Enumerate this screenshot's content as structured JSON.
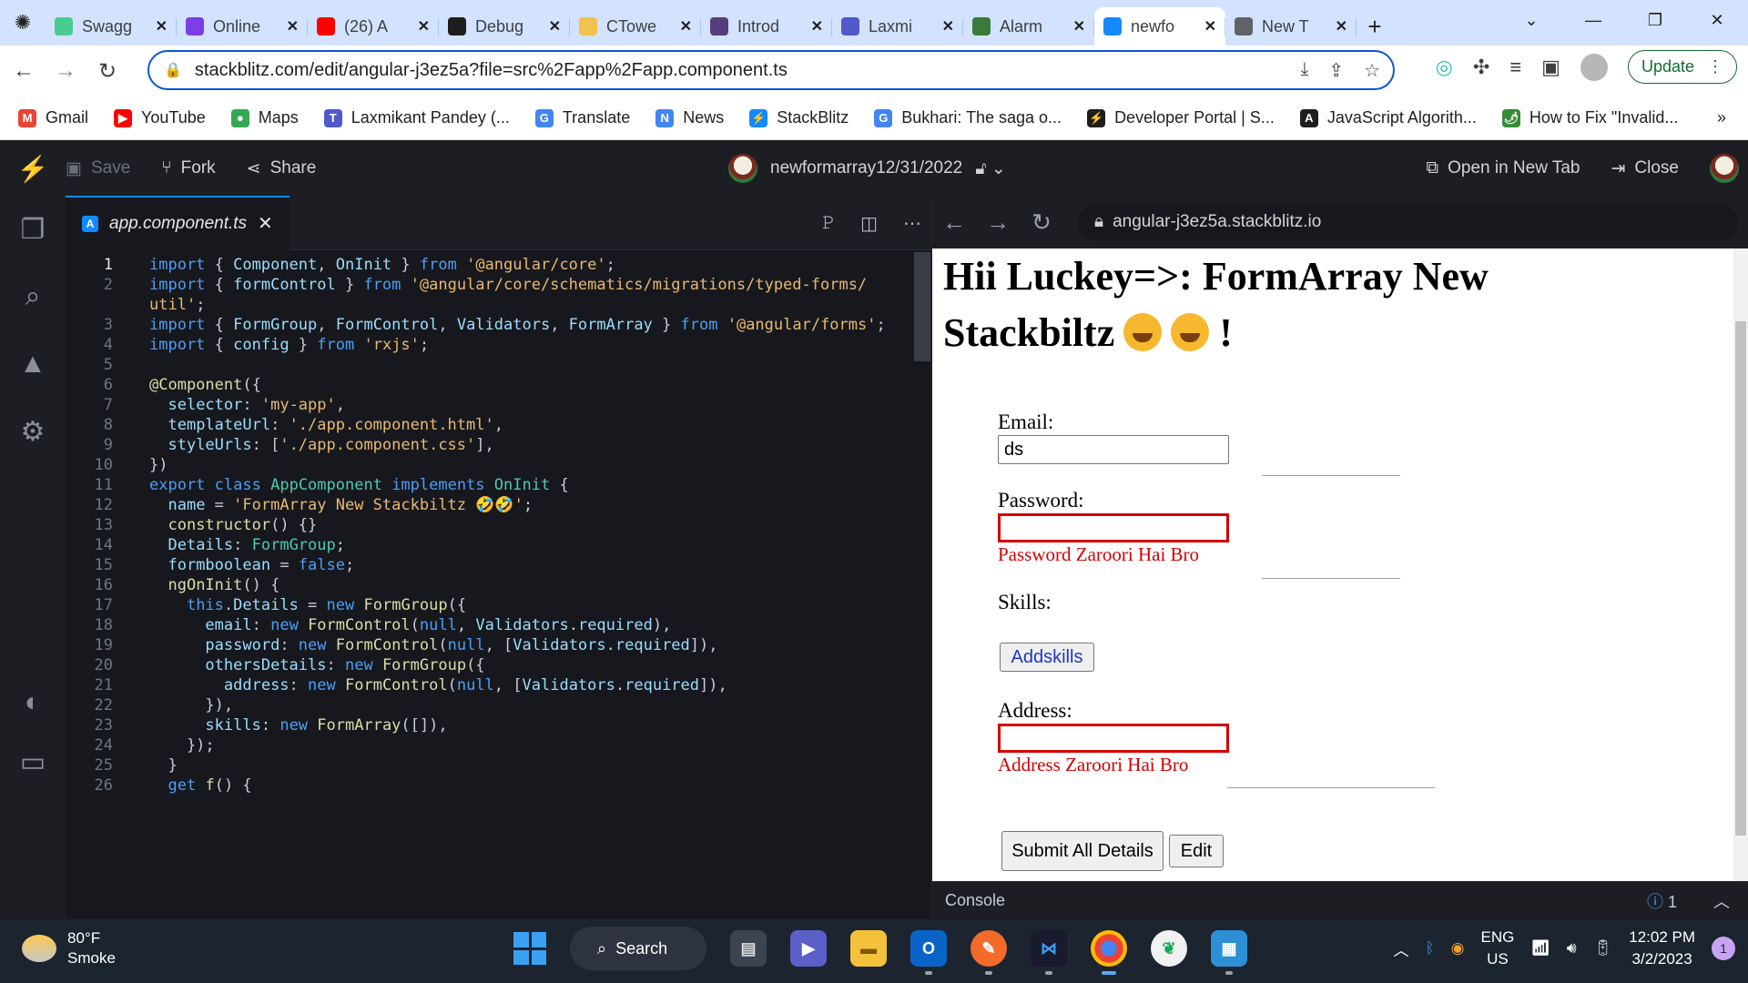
{
  "browser": {
    "tabs": [
      {
        "label": "Swagg",
        "icon": "swagger-icon",
        "color": "#49cc90"
      },
      {
        "label": "Online",
        "icon": "online-icon",
        "color": "#7b3fe4"
      },
      {
        "label": "(26) A",
        "icon": "youtube-icon",
        "color": "#ff0000"
      },
      {
        "label": "Debug",
        "icon": "debug-icon",
        "color": "#1e1e1e"
      },
      {
        "label": "CTowe",
        "icon": "ctower-icon",
        "color": "#f2c14e"
      },
      {
        "label": "Introd",
        "icon": "bootstrap-icon",
        "color": "#563d7c"
      },
      {
        "label": "Laxmi",
        "icon": "teams-icon",
        "color": "#5059c9"
      },
      {
        "label": "Alarm",
        "icon": "alarm-icon",
        "color": "#3a7a3a"
      },
      {
        "label": "newfo",
        "icon": "stackblitz-icon",
        "color": "#1389fd",
        "active": true
      },
      {
        "label": "New T",
        "icon": "chrome-icon",
        "color": "#5f6368"
      }
    ],
    "url": "stackblitz.com/edit/angular-j3ez5a?file=src%2Fapp%2Fapp.component.ts",
    "update_label": "Update",
    "bookmarks": [
      {
        "label": "Gmail",
        "color": "#ea4335",
        "glyph": "M"
      },
      {
        "label": "YouTube",
        "color": "#ff0000",
        "glyph": "▶"
      },
      {
        "label": "Maps",
        "color": "#34a853",
        "glyph": "●"
      },
      {
        "label": "Laxmikant Pandey (...",
        "color": "#5059c9",
        "glyph": "T"
      },
      {
        "label": "Translate",
        "color": "#4285f4",
        "glyph": "G"
      },
      {
        "label": "News",
        "color": "#4285f4",
        "glyph": "N"
      },
      {
        "label": "StackBlitz",
        "color": "#1389fd",
        "glyph": "⚡"
      },
      {
        "label": "Bukhari: The saga o...",
        "color": "#4285f4",
        "glyph": "G"
      },
      {
        "label": "Developer Portal | S...",
        "color": "#1e1e1e",
        "glyph": "⚡"
      },
      {
        "label": "JavaScript Algorith...",
        "color": "#1e1e1e",
        "glyph": "A"
      },
      {
        "label": "How to Fix \"Invalid...",
        "color": "#3a8a3a",
        "glyph": "🌶"
      }
    ],
    "bookmarks_more": "»"
  },
  "stackblitz": {
    "save_label": "Save",
    "fork_label": "Fork",
    "share_label": "Share",
    "project_title": "newformarray12/31/2022",
    "open_new_tab_label": "Open in New Tab",
    "close_label": "Close"
  },
  "editor": {
    "tab_label": "app.component.ts",
    "lines": [
      {
        "n": "1",
        "tokens": [
          [
            "kw",
            "import"
          ],
          [
            "pun",
            " { "
          ],
          [
            "id",
            "Component"
          ],
          [
            "pun",
            ", "
          ],
          [
            "id",
            "OnInit"
          ],
          [
            "pun",
            " } "
          ],
          [
            "kw",
            "from"
          ],
          [
            "pun",
            " "
          ],
          [
            "str",
            "'@angular/core'"
          ],
          [
            "pun",
            ";"
          ]
        ]
      },
      {
        "n": "2",
        "tokens": [
          [
            "kw",
            "import"
          ],
          [
            "pun",
            " { "
          ],
          [
            "id",
            "formControl"
          ],
          [
            "pun",
            " } "
          ],
          [
            "kw",
            "from"
          ],
          [
            "pun",
            " "
          ],
          [
            "str",
            "'@angular/core/schematics/migrations/typed-forms/"
          ]
        ]
      },
      {
        "n": "",
        "tokens": [
          [
            "str",
            "util'"
          ],
          [
            "pun",
            ";"
          ]
        ]
      },
      {
        "n": "3",
        "tokens": [
          [
            "kw",
            "import"
          ],
          [
            "pun",
            " { "
          ],
          [
            "id",
            "FormGroup"
          ],
          [
            "pun",
            ", "
          ],
          [
            "id",
            "FormControl"
          ],
          [
            "pun",
            ", "
          ],
          [
            "id",
            "Validators"
          ],
          [
            "pun",
            ", "
          ],
          [
            "id",
            "FormArray"
          ],
          [
            "pun",
            " } "
          ],
          [
            "kw",
            "from"
          ],
          [
            "pun",
            " "
          ],
          [
            "str",
            "'@angular/forms'"
          ],
          [
            "pun",
            ";"
          ]
        ]
      },
      {
        "n": "4",
        "tokens": [
          [
            "kw",
            "import"
          ],
          [
            "pun",
            " { "
          ],
          [
            "id",
            "config"
          ],
          [
            "pun",
            " } "
          ],
          [
            "kw",
            "from"
          ],
          [
            "pun",
            " "
          ],
          [
            "str",
            "'rxjs'"
          ],
          [
            "pun",
            ";"
          ]
        ]
      },
      {
        "n": "5",
        "tokens": []
      },
      {
        "n": "6",
        "tokens": [
          [
            "fn",
            "@Component"
          ],
          [
            "pun",
            "({"
          ]
        ]
      },
      {
        "n": "7",
        "tokens": [
          [
            "pun",
            "  "
          ],
          [
            "id",
            "selector"
          ],
          [
            "pun",
            ": "
          ],
          [
            "str",
            "'my-app'"
          ],
          [
            "pun",
            ","
          ]
        ]
      },
      {
        "n": "8",
        "tokens": [
          [
            "pun",
            "  "
          ],
          [
            "id",
            "templateUrl"
          ],
          [
            "pun",
            ": "
          ],
          [
            "str",
            "'./app.component.html'"
          ],
          [
            "pun",
            ","
          ]
        ]
      },
      {
        "n": "9",
        "tokens": [
          [
            "pun",
            "  "
          ],
          [
            "id",
            "styleUrls"
          ],
          [
            "pun",
            ": ["
          ],
          [
            "str",
            "'./app.component.css'"
          ],
          [
            "pun",
            "],"
          ]
        ]
      },
      {
        "n": "10",
        "tokens": [
          [
            "pun",
            "})"
          ]
        ]
      },
      {
        "n": "11",
        "tokens": [
          [
            "kw",
            "export"
          ],
          [
            "pun",
            " "
          ],
          [
            "kw",
            "class"
          ],
          [
            "pun",
            " "
          ],
          [
            "cls",
            "AppComponent"
          ],
          [
            "pun",
            " "
          ],
          [
            "kw",
            "implements"
          ],
          [
            "pun",
            " "
          ],
          [
            "cls",
            "OnInit"
          ],
          [
            "pun",
            " {"
          ]
        ]
      },
      {
        "n": "12",
        "tokens": [
          [
            "pun",
            "  "
          ],
          [
            "id",
            "name"
          ],
          [
            "pun",
            " = "
          ],
          [
            "str",
            "'FormArray New Stackbiltz 🤣🤣'"
          ],
          [
            "pun",
            ";"
          ]
        ]
      },
      {
        "n": "13",
        "tokens": [
          [
            "pun",
            "  "
          ],
          [
            "fn",
            "constructor"
          ],
          [
            "pun",
            "() {}"
          ]
        ]
      },
      {
        "n": "14",
        "tokens": [
          [
            "pun",
            "  "
          ],
          [
            "id",
            "Details"
          ],
          [
            "pun",
            ": "
          ],
          [
            "cls",
            "FormGroup"
          ],
          [
            "pun",
            ";"
          ]
        ]
      },
      {
        "n": "15",
        "tokens": [
          [
            "pun",
            "  "
          ],
          [
            "id",
            "formboolean"
          ],
          [
            "pun",
            " = "
          ],
          [
            "bool",
            "false"
          ],
          [
            "pun",
            ";"
          ]
        ]
      },
      {
        "n": "16",
        "tokens": [
          [
            "pun",
            "  "
          ],
          [
            "fn",
            "ngOnInit"
          ],
          [
            "pun",
            "() {"
          ]
        ]
      },
      {
        "n": "17",
        "tokens": [
          [
            "pun",
            "    "
          ],
          [
            "kw",
            "this"
          ],
          [
            "pun",
            "."
          ],
          [
            "id",
            "Details"
          ],
          [
            "pun",
            " = "
          ],
          [
            "kw",
            "new"
          ],
          [
            "pun",
            " "
          ],
          [
            "fn",
            "FormGroup"
          ],
          [
            "pun",
            "({"
          ]
        ]
      },
      {
        "n": "18",
        "tokens": [
          [
            "pun",
            "      "
          ],
          [
            "id",
            "email"
          ],
          [
            "pun",
            ": "
          ],
          [
            "kw",
            "new"
          ],
          [
            "pun",
            " "
          ],
          [
            "fn",
            "FormControl"
          ],
          [
            "pun",
            "("
          ],
          [
            "kw",
            "null"
          ],
          [
            "pun",
            ", "
          ],
          [
            "id",
            "Validators"
          ],
          [
            "pun",
            "."
          ],
          [
            "id",
            "required"
          ],
          [
            "pun",
            "),"
          ]
        ]
      },
      {
        "n": "19",
        "tokens": [
          [
            "pun",
            "      "
          ],
          [
            "id",
            "password"
          ],
          [
            "pun",
            ": "
          ],
          [
            "kw",
            "new"
          ],
          [
            "pun",
            " "
          ],
          [
            "fn",
            "FormControl"
          ],
          [
            "pun",
            "("
          ],
          [
            "kw",
            "null"
          ],
          [
            "pun",
            ", ["
          ],
          [
            "id",
            "Validators"
          ],
          [
            "pun",
            "."
          ],
          [
            "id",
            "required"
          ],
          [
            "pun",
            "]),"
          ]
        ]
      },
      {
        "n": "20",
        "tokens": [
          [
            "pun",
            "      "
          ],
          [
            "id",
            "othersDetails"
          ],
          [
            "pun",
            ": "
          ],
          [
            "kw",
            "new"
          ],
          [
            "pun",
            " "
          ],
          [
            "fn",
            "FormGroup"
          ],
          [
            "pun",
            "({"
          ]
        ]
      },
      {
        "n": "21",
        "tokens": [
          [
            "pun",
            "        "
          ],
          [
            "id",
            "address"
          ],
          [
            "pun",
            ": "
          ],
          [
            "kw",
            "new"
          ],
          [
            "pun",
            " "
          ],
          [
            "fn",
            "FormControl"
          ],
          [
            "pun",
            "("
          ],
          [
            "kw",
            "null"
          ],
          [
            "pun",
            ", ["
          ],
          [
            "id",
            "Validators"
          ],
          [
            "pun",
            "."
          ],
          [
            "id",
            "required"
          ],
          [
            "pun",
            "]),"
          ]
        ]
      },
      {
        "n": "22",
        "tokens": [
          [
            "pun",
            "      }),"
          ]
        ]
      },
      {
        "n": "23",
        "tokens": [
          [
            "pun",
            "      "
          ],
          [
            "id",
            "skills"
          ],
          [
            "pun",
            ": "
          ],
          [
            "kw",
            "new"
          ],
          [
            "pun",
            " "
          ],
          [
            "fn",
            "FormArray"
          ],
          [
            "pun",
            "([]),"
          ]
        ]
      },
      {
        "n": "24",
        "tokens": [
          [
            "pun",
            "    });"
          ]
        ]
      },
      {
        "n": "25",
        "tokens": [
          [
            "pun",
            "  }"
          ]
        ]
      },
      {
        "n": "26",
        "tokens": [
          [
            "pun",
            "  "
          ],
          [
            "kw",
            "get"
          ],
          [
            "pun",
            " "
          ],
          [
            "fn",
            "f"
          ],
          [
            "pun",
            "() {"
          ]
        ]
      }
    ]
  },
  "preview": {
    "url": "angular-j3ez5a.stackblitz.io",
    "heading_line1": "Hii Luckey=>: FormArray New",
    "heading_line2": "Stackbiltz",
    "heading_suffix": "!",
    "email_label": "Email:",
    "email_value": "ds",
    "password_label": "Password:",
    "password_error": "Password Zaroori Hai Bro",
    "skills_label": "Skills:",
    "add_skills_label": "Addskills",
    "address_label": "Address:",
    "address_error": "Address Zaroori Hai Bro",
    "submit_label": "Submit All Details",
    "edit_label": "Edit"
  },
  "console": {
    "label": "Console",
    "info_count": "1"
  },
  "taskbar": {
    "temperature": "80°F",
    "weather": "Smoke",
    "search_label": "Search",
    "lang_line1": "ENG",
    "lang_line2": "US",
    "time": "12:02 PM",
    "date": "3/2/2023",
    "notification_count": "1"
  }
}
